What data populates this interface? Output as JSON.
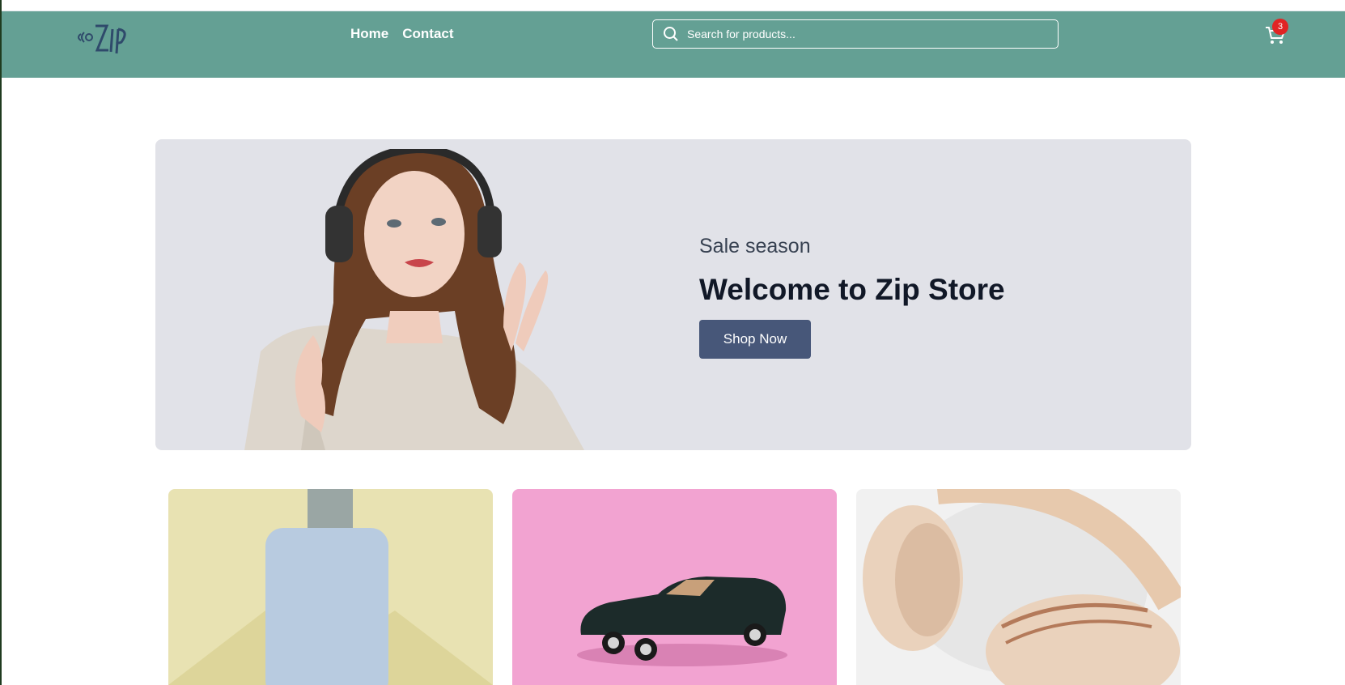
{
  "nav": {
    "logo_text": "Zip",
    "links": [
      {
        "label": "Home"
      },
      {
        "label": "Contact"
      }
    ],
    "search_placeholder": "Search for products...",
    "cart_count": "3"
  },
  "hero": {
    "subtitle": "Sale season",
    "title": "Welcome to Zip Store",
    "cta_label": "Shop Now"
  },
  "products": [
    {
      "image": "blue-bottle-on-yellow"
    },
    {
      "image": "toy-car-on-pink"
    },
    {
      "image": "beige-headphones"
    }
  ],
  "colors": {
    "navbar": "#64a094",
    "hero_bg": "#e1e2e8",
    "cta": "#475779",
    "badge": "#e02424"
  }
}
